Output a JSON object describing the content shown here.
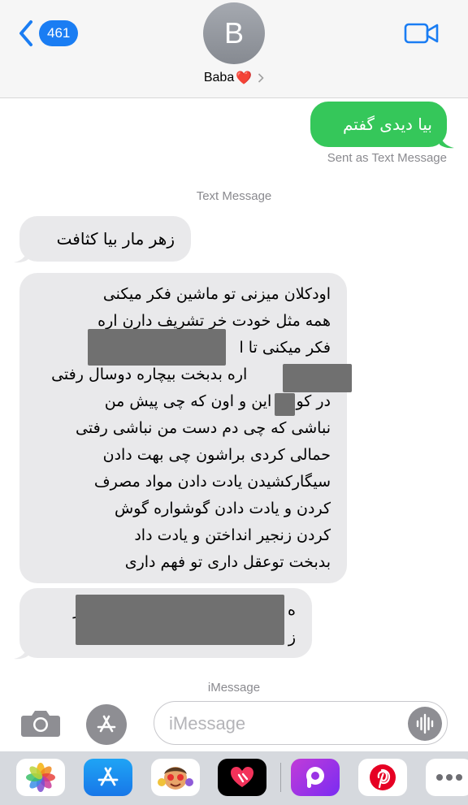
{
  "header": {
    "back_count": "461",
    "avatar_letter": "B",
    "contact_name": "Baba",
    "contact_emoji": "❤️"
  },
  "messages": {
    "outgoing_1": "بیا دیدی گفتم",
    "sent_as": "Sent as Text Message",
    "label_text_message": "Text Message",
    "incoming_1": "زهر مار بیا کثافت",
    "incoming_2_lines": [
      "اودکلان میزنی تو ماشین فکر میکنی",
      "همه مثل خودت خر تشریف دارن اره",
      "فکر میکنی تا ا                      ت",
      "                 اره بدبخت بیچاره دوسال رفتی",
      "در کو     این و اون که چی پیش من",
      "نباشی که چی دم دست من نباشی رفتی",
      "حمالی کردی براشون چی بهت دادن",
      "سیگارکشیدن یادت دادن مواد مصرف",
      "کردن و یادت دادن  گوشواره گوش",
      "کردن زنجیر انداختن و یادت داد",
      "بدبخت توعقل داری تو فهم داری"
    ],
    "incoming_3_lines": [
      "ه                                    حطور",
      "ز"
    ],
    "label_imessage": "iMessage"
  },
  "input": {
    "placeholder": "iMessage"
  },
  "colors": {
    "accent_blue": "#1a7df3",
    "sms_green": "#35c75a",
    "incoming_gray": "#e9e9eb",
    "redaction_gray": "#707070"
  },
  "app_strip": {
    "icons": [
      "photos-icon",
      "app-store-icon",
      "memoji-icon",
      "digital-touch-icon",
      "picsart-icon",
      "pinterest-icon",
      "more-icon"
    ]
  }
}
